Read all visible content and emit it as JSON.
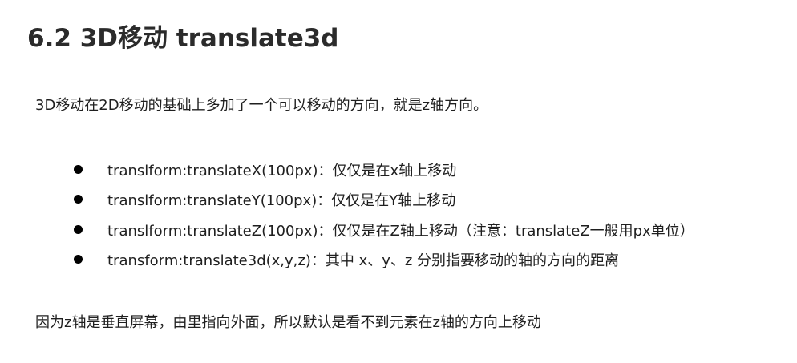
{
  "heading": "6.2 3D移动 translate3d",
  "intro": "3D移动在2D移动的基础上多加了一个可以移动的方向，就是z轴方向。",
  "bullets": [
    "translform:translateX(100px)：仅仅是在x轴上移动",
    "translform:translateY(100px)：仅仅是在Y轴上移动",
    "translform:translateZ(100px)：仅仅是在Z轴上移动（注意：translateZ一般用px单位）",
    "transform:translate3d(x,y,z)：其中 x、y、z 分别指要移动的轴的方向的距离"
  ],
  "outro": "因为z轴是垂直屏幕，由里指向外面，所以默认是看不到元素在z轴的方向上移动"
}
